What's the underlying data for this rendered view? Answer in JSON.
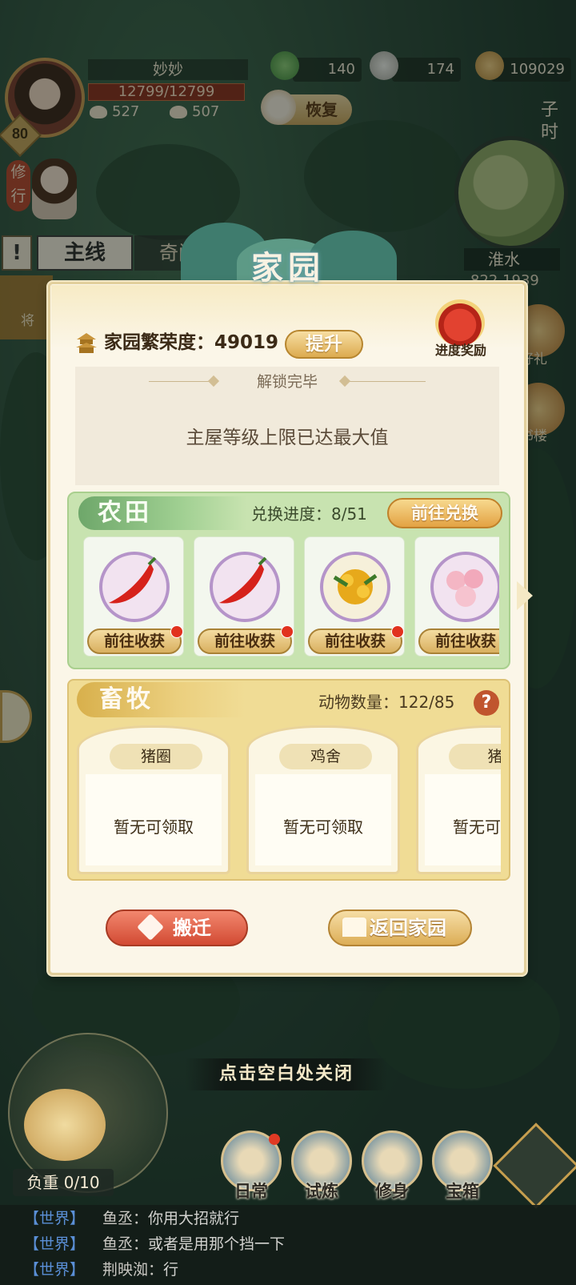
{
  "player": {
    "name": "妙妙",
    "level": "80",
    "hp": "12799/12799",
    "stat_a": "527",
    "stat_b": "507"
  },
  "resources": [
    {
      "icon": "jade-icon",
      "value": "140"
    },
    {
      "icon": "silver-ingot-icon",
      "value": "174"
    },
    {
      "icon": "coin-icon",
      "value": "109029"
    }
  ],
  "recover_label": "恢复",
  "time_label": "子时",
  "practice_label": "修行",
  "map": {
    "location": "淮水",
    "coords": "822,1939"
  },
  "quest_tabs": {
    "main": "主线",
    "odd": "奇闻"
  },
  "side_text": "将",
  "side_labels": {
    "gift": "好礼",
    "bookhouse": "书楼"
  },
  "panel": {
    "title": "家园",
    "prosperity_label": "家园繁荣度：49019",
    "upgrade": "提升",
    "progress_reward": "进度奖励",
    "unlock_title": "解锁完毕",
    "unlock_text": "主屋等级上限已达最大值"
  },
  "farmland": {
    "title": "农田",
    "exchange_progress": "兑换进度：8/51",
    "exchange_button": "前往兑换",
    "crops": [
      {
        "icon": "chili-pepper-icon",
        "button": "前往收获",
        "notify": true
      },
      {
        "icon": "chili-pepper-icon",
        "button": "前往收获",
        "notify": true
      },
      {
        "icon": "osmanthus-flower-icon",
        "button": "前往收获",
        "notify": true
      },
      {
        "icon": "pink-blossom-icon",
        "button": "前往收获",
        "notify": false
      }
    ]
  },
  "livestock": {
    "title": "畜牧",
    "animal_count": "动物数量：122/85",
    "pens": [
      {
        "name": "猪圈",
        "status": "暂无可领取"
      },
      {
        "name": "鸡舍",
        "status": "暂无可领取"
      },
      {
        "name": "猪",
        "status": "暂无可领取"
      }
    ]
  },
  "actions": {
    "move": "搬迁",
    "back": "返回家园"
  },
  "tap_close": "点击空白处关闭",
  "cart_weight": "负重 0/10",
  "dock": [
    {
      "label": "日常",
      "notify": true
    },
    {
      "label": "试炼",
      "notify": false
    },
    {
      "label": "修身",
      "notify": false
    },
    {
      "label": "宝箱",
      "notify": false
    }
  ],
  "chat": [
    {
      "channel": "【世界】",
      "who": "鱼丞：",
      "text": "你用大招就行"
    },
    {
      "channel": "【世界】",
      "who": "鱼丞：",
      "text": "或者是用那个挡一下"
    },
    {
      "channel": "【世界】",
      "who": "荆映洳：",
      "text": "行"
    }
  ],
  "colors": {
    "accent_gold": "#dcab50",
    "farm_green": "#c8e3b0",
    "livestock_yellow": "#f0dc95",
    "move_red": "#d24a33",
    "chat_channel": "#5a8fd6"
  }
}
